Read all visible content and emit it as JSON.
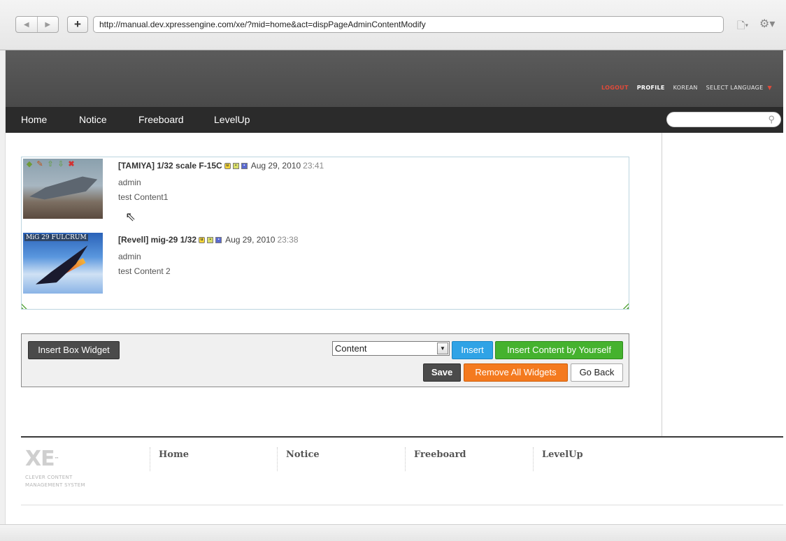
{
  "browser": {
    "url": "http://manual.dev.xpressengine.com/xe/?mid=home&act=dispPageAdminContentModify",
    "back_glyph": "◀",
    "forward_glyph": "▶",
    "new_tab_glyph": "+",
    "page_menu_glyph": "🗋▾",
    "tools_menu_glyph": "⚙▾"
  },
  "header": {
    "logout": "LOGOUT",
    "profile": "PROFILE",
    "korean": "KOREAN",
    "select_language": "SELECT LANGUAGE",
    "lang_arrow": "▼"
  },
  "nav": {
    "items": [
      "Home",
      "Notice",
      "Freeboard",
      "LevelUp"
    ],
    "search_placeholder": ""
  },
  "widget": {
    "toolbar_icons": [
      "cube-icon",
      "edit-icon",
      "move-up-icon",
      "move-down-icon",
      "delete-icon"
    ],
    "posts": [
      {
        "title": "[TAMIYA] 1/32 scale F-15C",
        "date": "Aug 29, 2010",
        "time": "23:41",
        "author": "admin",
        "content": "test Content1"
      },
      {
        "title": "[Revell] mig-29 1/32",
        "date": "Aug 29, 2010",
        "time": "23:38",
        "author": "admin",
        "content": "test Content 2",
        "image_label": "MiG 29 FULCRUM"
      }
    ]
  },
  "admin": {
    "insert_box_widget": "Insert Box Widget",
    "content_select_value": "Content",
    "insert": "Insert",
    "insert_content_by_yourself": "Insert Content by Yourself",
    "save": "Save",
    "remove_all_widgets": "Remove All Widgets",
    "go_back": "Go Back"
  },
  "footer": {
    "logo": "XE",
    "logo_tm": "™",
    "tagline_1": "CLEVER CONTENT",
    "tagline_2": "MANAGEMENT SYSTEM",
    "nav": [
      "Home",
      "Notice",
      "Freeboard",
      "LevelUp"
    ]
  },
  "colors": {
    "logout": "#e04a3a",
    "insert_button": "#2fa3e6",
    "insert_content_button": "#45b22e",
    "remove_all_button": "#f47a1f",
    "dark_button": "#4b4b4b",
    "nav_bar": "#2b2b2b"
  }
}
